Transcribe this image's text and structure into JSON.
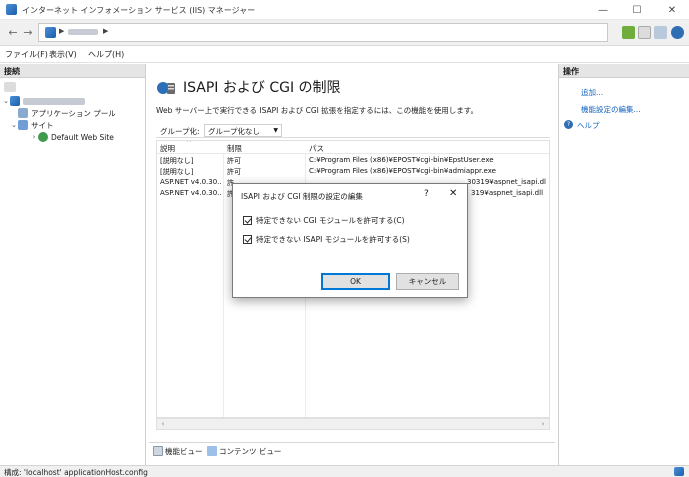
{
  "window": {
    "title": "インターネット インフォメーション サービス (IIS) マネージャー",
    "minimize": "—",
    "maximize": "☐",
    "close": "✕"
  },
  "address": {
    "back": "←",
    "forward": "→",
    "sep": "▶"
  },
  "menu": {
    "file": "ファイル(F)",
    "view": "表示(V)",
    "help": "ヘルプ(H)"
  },
  "connections": {
    "header": "接続",
    "items": {
      "app_pools": "アプリケーション プール",
      "sites": "サイト",
      "default_site": "Default Web Site"
    }
  },
  "feature": {
    "title": "ISAPI および CGI の制限",
    "description": "Web サーバー上で実行できる ISAPI および CGI 拡張を指定するには、この機能を使用します。",
    "group_label": "グループ化:",
    "group_value": "グループ化なし",
    "columns": {
      "description": "説明",
      "restriction": "制限",
      "path": "パス"
    },
    "rows": [
      {
        "description": "[説明なし]",
        "restriction": "許可",
        "path": "C:¥Program Files (x86)¥EPOST¥cgi-bin¥EpstUser.exe"
      },
      {
        "description": "[説明なし]",
        "restriction": "許可",
        "path": "C:¥Program Files (x86)¥EPOST¥cgi-bin¥admiappr.exe"
      },
      {
        "description": "ASP.NET v4.0.30...",
        "restriction": "許",
        "path": "30319¥aspnet_isapi.dl"
      },
      {
        "description": "ASP.NET v4.0.30...",
        "restriction": "許",
        "path": "319¥aspnet_isapi.dll"
      }
    ]
  },
  "view_tabs": {
    "features": "機能ビュー",
    "content": "コンテンツ ビュー"
  },
  "actions": {
    "header": "操作",
    "add": "追加...",
    "edit_settings": "機能設定の編集...",
    "help": "ヘルプ"
  },
  "status": {
    "text": "構成: 'localhost' applicationHost.config"
  },
  "dialog": {
    "title": "ISAPI および CGI 制限の設定の編集",
    "help": "?",
    "close": "✕",
    "check_cgi": "特定できない CGI モジュールを許可する(C)",
    "check_isapi": "特定できない ISAPI モジュールを許可する(S)",
    "ok": "OK",
    "cancel": "キャンセル"
  },
  "colors": {
    "accent": "#0078d7",
    "link": "#1565c0"
  }
}
